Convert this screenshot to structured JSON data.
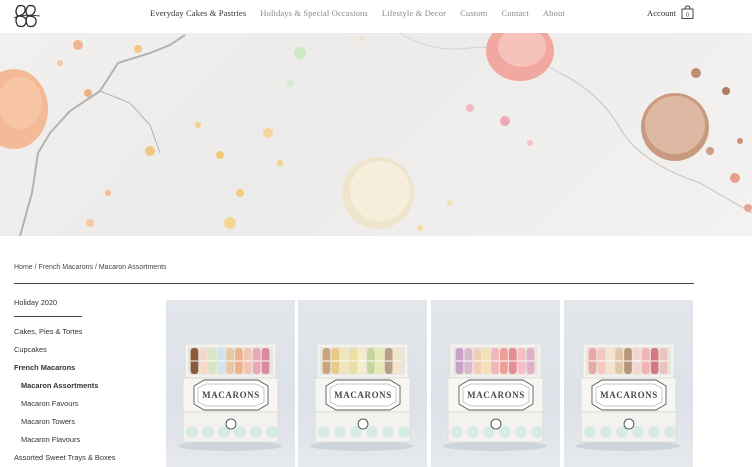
{
  "header": {
    "logo_icon": "bb-monogram-logo",
    "nav": [
      {
        "label": "Everyday Cakes & Pastries",
        "active": true
      },
      {
        "label": "Holidays & Special Occasions",
        "active": false
      },
      {
        "label": "Lifestyle & Decor",
        "active": false
      },
      {
        "label": "Custom",
        "active": false
      },
      {
        "label": "Contact",
        "active": false
      },
      {
        "label": "About",
        "active": false
      }
    ],
    "account_label": "Account",
    "cart_count": "0",
    "cart_icon": "shopping-bag-icon"
  },
  "hero": {
    "image": "macarons-on-marble"
  },
  "breadcrumb": {
    "items": [
      "Home",
      "French Macarons",
      "Macaron Assortments"
    ],
    "separator": " / "
  },
  "sidebar": {
    "items": [
      {
        "label": "Holiday 2020",
        "level": 0,
        "bold": false
      },
      {
        "label": "Cakes, Pies & Tortes",
        "level": 0,
        "bold": false
      },
      {
        "label": "Cupcakes",
        "level": 0,
        "bold": false
      },
      {
        "label": "French Macarons",
        "level": 0,
        "bold": true
      },
      {
        "label": "Macaron Assortments",
        "level": 1,
        "bold": true
      },
      {
        "label": "Macaron Favours",
        "level": 1,
        "bold": false
      },
      {
        "label": "Macaron Towers",
        "level": 1,
        "bold": false
      },
      {
        "label": "Macaron Flavours",
        "level": 1,
        "bold": false
      },
      {
        "label": "Assorted Sweet Trays & Boxes",
        "level": 0,
        "bold": false
      }
    ]
  },
  "products": [
    {
      "box_label": "MACARONS",
      "colors": [
        "#8a5a3c",
        "#f3d9c9",
        "#d8e6c2",
        "#cfe3ec",
        "#e7c7a6",
        "#f0b08c",
        "#f2c5b5",
        "#e9a8b6",
        "#d98aa3"
      ]
    },
    {
      "box_label": "MACARONS",
      "colors": [
        "#c9a57a",
        "#e8c98a",
        "#f2e6b8",
        "#e9dfa0",
        "#f5ecc8",
        "#c7d59a",
        "#e6e8b8",
        "#b99f7f",
        "#f1e6cd"
      ]
    },
    {
      "box_label": "MACARONS",
      "colors": [
        "#c8a2c8",
        "#d9b7cf",
        "#f0cfb8",
        "#f5e0b4",
        "#f2b6b6",
        "#ef9f9a",
        "#e98b94",
        "#f4c0c6",
        "#dfb0c8"
      ]
    },
    {
      "box_label": "MACARONS",
      "colors": [
        "#e8a9a2",
        "#f2c9c2",
        "#f6e3ce",
        "#e0c7a8",
        "#b9957a",
        "#f4d5d0",
        "#efb2b6",
        "#d47882",
        "#e9c4bf"
      ]
    }
  ]
}
